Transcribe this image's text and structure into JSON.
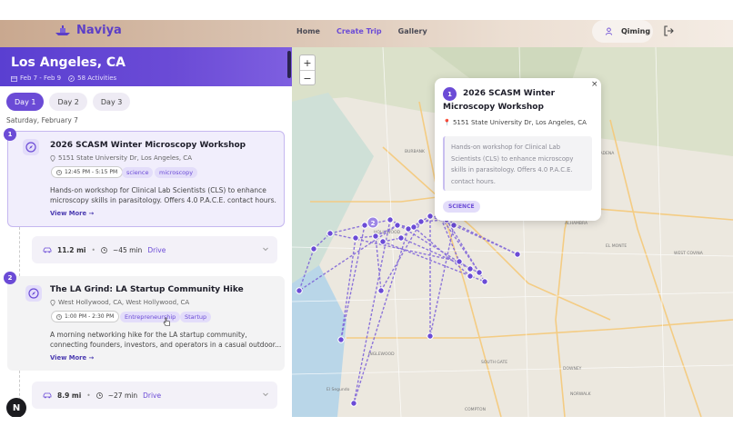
{
  "brand": {
    "name": "Naviya"
  },
  "nav": {
    "home": "Home",
    "create_trip": "Create Trip",
    "gallery": "Gallery"
  },
  "user": {
    "name": "Qiming"
  },
  "trip": {
    "city": "Los Angeles, CA",
    "dates": "Feb 7 - Feb 9",
    "activities": "58 Activities"
  },
  "days": [
    "Day 1",
    "Day 2",
    "Day 3"
  ],
  "date_label": "Saturday, February 7",
  "events": [
    {
      "num": "1",
      "title": "2026 SCASM Winter Microscopy Workshop",
      "address": "5151 State University Dr, Los Angeles, CA",
      "time": "12:45 PM - 5:15 PM",
      "tags": [
        "science",
        "microscopy"
      ],
      "desc_line1": "Hands-on workshop for Clinical Lab Scientists (CLS) to enhance",
      "desc_line2": "microscopy skills in parasitology. Offers 4.0 P.A.C.E. contact hours.",
      "more": "View More →"
    },
    {
      "num": "2",
      "title": "The LA Grind: LA Startup Community Hike",
      "address": "West Hollywood, CA, West Hollywood, CA",
      "time": "1:00 PM - 2:30 PM",
      "tags": [
        "Entrepreneurship",
        "Startup"
      ],
      "desc_line1": "A morning networking hike for the LA startup community,",
      "desc_line2": "connecting founders, investors, and operators in a casual outdoor...",
      "more": "View More →"
    }
  ],
  "travel": [
    {
      "distance": "11.2 mi",
      "duration": "~45 min",
      "mode": "Drive"
    },
    {
      "distance": "8.9 mi",
      "duration": "~27 min",
      "mode": "Drive"
    }
  ],
  "map": {
    "zoom_in": "+",
    "zoom_out": "−",
    "cluster_count": "2",
    "labels": [
      "BURBANK",
      "GLENDALE",
      "PASADENA",
      "ALHAMBRA",
      "EL MONTE",
      "WEST COVINA",
      "INGLEWOOD",
      "DOWNEY",
      "NORWALK",
      "COMPTON",
      "SOUTH GATE",
      "El Segundo",
      "HOLLYWOOD"
    ]
  },
  "popup": {
    "num": "1",
    "title": "2026 SCASM Winter Microscopy Workshop",
    "address": "5151 State University Dr, Los Angeles, CA",
    "desc": "Hands-on workshop for Clinical Lab Scientists (CLS) to enhance microscopy skills in parasitology. Offers 4.0 P.A.C.E. contact hours.",
    "tag": "SCIENCE",
    "close": "×"
  },
  "badge": "N",
  "colors": {
    "accent": "#6b4bd6",
    "route": "#7b5fd9"
  }
}
